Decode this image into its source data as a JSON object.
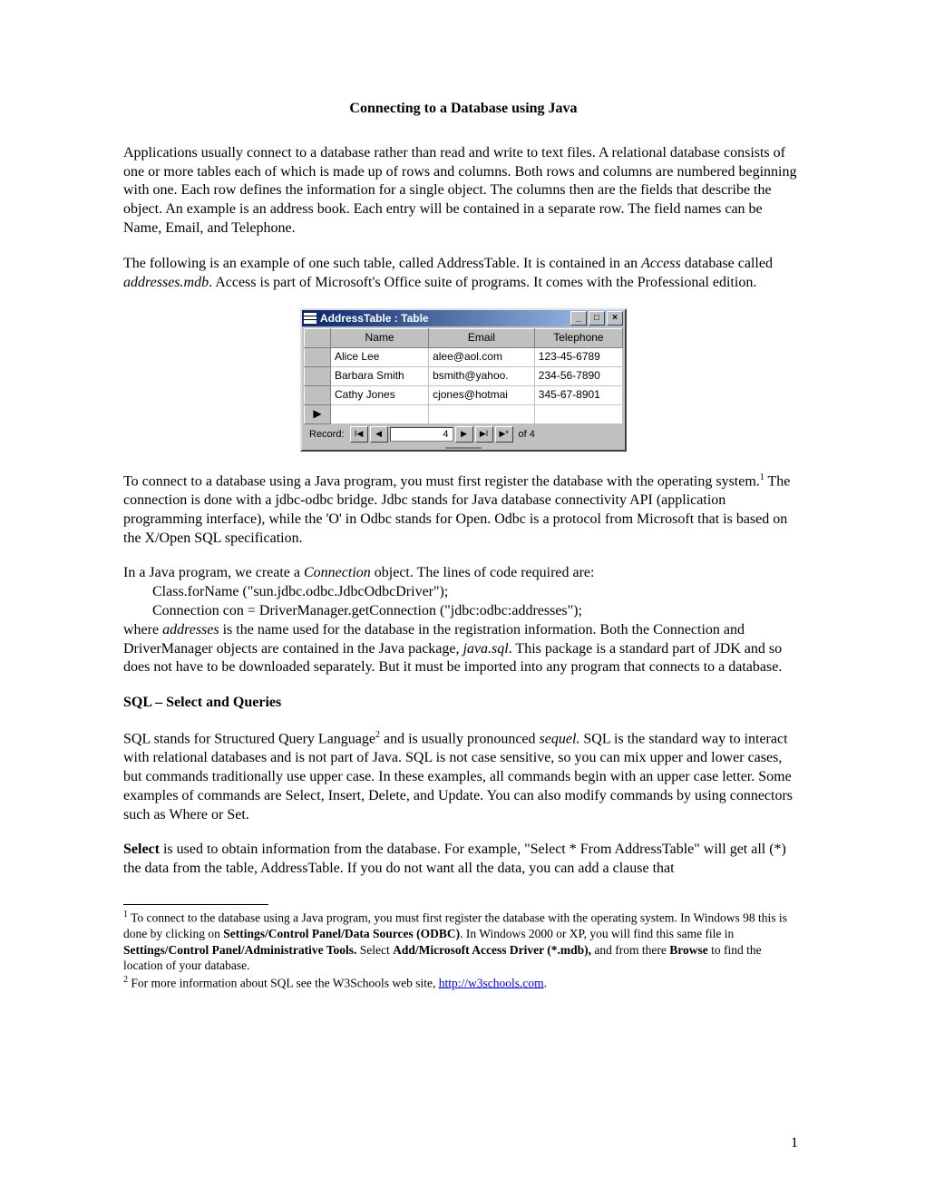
{
  "title": "Connecting to a Database using Java",
  "p1": "Applications usually connect to a database rather than read and write to text files.  A relational database consists of one or more tables each of which is made up of rows and columns.  Both rows and columns are numbered beginning with one.  Each row defines the information for a single object.  The columns then are the fields that describe the object.  An example is an address book.  Each entry will be contained in a separate row.  The field names can be Name, Email, and Telephone.",
  "p2a": "The following is an example of one such table, called AddressTable.  It is contained in an ",
  "p2b": "Access",
  "p2c": " database called ",
  "p2d": "addresses.mdb",
  "p2e": ".  Access is part of Microsoft's Office suite of programs.  It comes with the Professional edition.",
  "access": {
    "window_title": "AddressTable : Table",
    "columns": [
      "Name",
      "Email",
      "Telephone"
    ],
    "rows": [
      {
        "name": "Alice Lee",
        "email": "alee@aol.com",
        "tel": "123-45-6789"
      },
      {
        "name": "Barbara Smith",
        "email": "bsmith@yahoo.",
        "tel": "234-56-7890"
      },
      {
        "name": "Cathy Jones",
        "email": "cjones@hotmai",
        "tel": "345-67-8901"
      }
    ],
    "nav": {
      "label": "Record:",
      "current": "4",
      "total": "of  4"
    }
  },
  "p3a": "To connect to a database using a Java program, you must first register the database with the operating system.",
  "p3sup": "1",
  "p3b": "   The connection is done with a jdbc-odbc bridge.  Jdbc stands for Java database connectivity API (application programming interface), while the 'O' in Odbc stands for Open.  Odbc is a protocol from Microsoft that is based on the X/Open SQL specification.",
  "p4a": "In a Java program, we create a ",
  "p4b": "Connection",
  "p4c": " object.  The lines of code required are:",
  "code1": "Class.forName (\"sun.jdbc.odbc.JdbcOdbcDriver\");",
  "code2": "Connection con = DriverManager.getConnection (\"jdbc:odbc:addresses\");",
  "p5a": "where ",
  "p5b": "addresses",
  "p5c": " is the name used for the database in the registration information.  Both the Connection and DriverManager objects are contained in the Java package, ",
  "p5d": "java.sql",
  "p5e": ".  This package is a standard part of JDK and so does not have to be downloaded separately.  But it must be imported into any program that connects to a database.",
  "h2": "SQL – Select and Queries",
  "p6a": "SQL stands for Structured Query Language",
  "p6sup": "2",
  "p6b": " and is usually pronounced ",
  "p6c": "sequel.",
  "p6d": "  SQL is the standard way to interact with relational databases and is not part of Java.   SQL is not case sensitive, so you can mix upper and lower cases, but commands traditionally use upper case.  In these examples, all commands begin with an upper case letter.  Some examples of commands are Select, Insert, Delete, and Update.  You can also modify commands by using connectors such as Where or Set.",
  "p7a": "Select",
  "p7b": " is used to obtain information from the database.  For example, \"Select * From AddressTable\" will get all (*) the data from the table, AddressTable.  If you do not want all the data, you can add a clause that",
  "fn1sup": "1",
  "fn1a": " To connect to the database using a Java program, you must first register the database with the operating system.  In Windows 98 this is done by clicking on ",
  "fn1b": "Settings/Control Panel/Data Sources (ODBC)",
  "fn1c": ".  In Windows 2000 or XP, you will find this same file in ",
  "fn1d": "Settings/Control Panel/Administrative Tools.",
  "fn1e": "  Select ",
  "fn1f": "Add/Microsoft Access Driver (*.mdb),",
  "fn1g": " and from there ",
  "fn1h": "Browse",
  "fn1i": " to find the location of your database.",
  "fn2sup": "2",
  "fn2a": " For more information about SQL see the W3Schools web site, ",
  "fn2link": "http://w3schools.com",
  "fn2b": ".",
  "pagenum": "1"
}
